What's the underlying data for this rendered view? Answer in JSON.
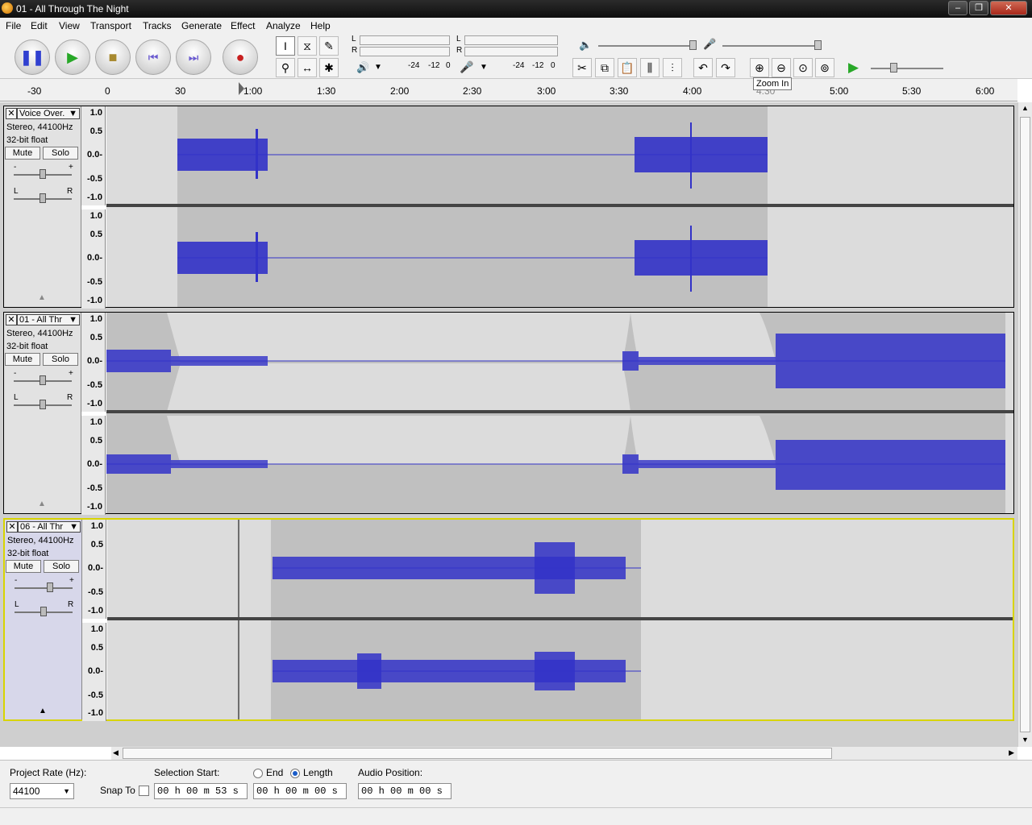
{
  "window": {
    "title": "01 - All Through The Night"
  },
  "menu": [
    "File",
    "Edit",
    "View",
    "Transport",
    "Tracks",
    "Generate",
    "Effect",
    "Analyze",
    "Help"
  ],
  "meters": {
    "left_ch": "L",
    "right_ch": "R",
    "play_db": [
      "-24",
      "-12",
      "0"
    ],
    "rec_db": [
      "-24",
      "-12",
      "0"
    ]
  },
  "tooltip": "Zoom In",
  "ruler_ticks": [
    "-30",
    "0",
    "30",
    "1:00",
    "1:30",
    "2:00",
    "2:30",
    "3:00",
    "3:30",
    "4:00",
    "4:30",
    "5:00",
    "5:30",
    "6:00"
  ],
  "tracks": [
    {
      "name": "Voice Over.",
      "info1": "Stereo, 44100Hz",
      "info2": "32-bit float",
      "mute": "Mute",
      "solo": "Solo",
      "gain_minus": "-",
      "gain_plus": "+",
      "pan_l": "L",
      "pan_r": "R"
    },
    {
      "name": "01 - All Thr",
      "info1": "Stereo, 44100Hz",
      "info2": "32-bit float",
      "mute": "Mute",
      "solo": "Solo",
      "gain_minus": "-",
      "gain_plus": "+",
      "pan_l": "L",
      "pan_r": "R"
    },
    {
      "name": "06 - All Thr",
      "info1": "Stereo, 44100Hz",
      "info2": "32-bit float",
      "mute": "Mute",
      "solo": "Solo",
      "gain_minus": "-",
      "gain_plus": "+",
      "pan_l": "L",
      "pan_r": "R"
    }
  ],
  "amp_labels": [
    "1.0",
    "0.5",
    "0.0-",
    "-0.5",
    "-1.0"
  ],
  "status": {
    "project_rate_label": "Project Rate (Hz):",
    "project_rate": "44100",
    "snap_to": "Snap To",
    "selection_start_label": "Selection Start:",
    "end_label": "End",
    "length_label": "Length",
    "audio_position_label": "Audio Position:",
    "selection_start": "00 h 00 m 53 s",
    "length": "00 h 00 m 00 s",
    "audio_position": "00 h 00 m 00 s"
  },
  "colors": {
    "wave": "#3232c8",
    "selected_bg": "#c0c0c0",
    "track_bg": "#dcdcdc"
  }
}
